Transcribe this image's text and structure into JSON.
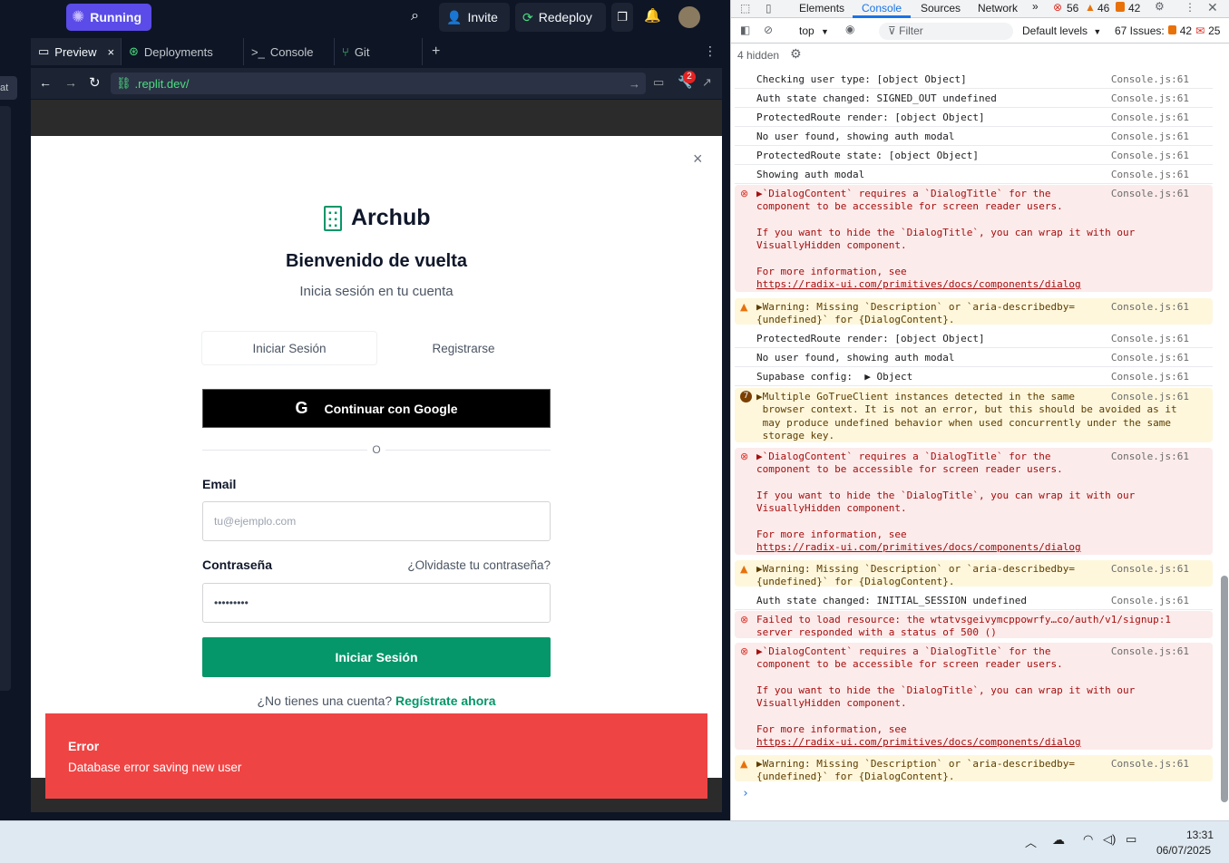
{
  "replit": {
    "run_status": "Running",
    "invite_label": "Invite",
    "redeploy_label": "Redeploy",
    "notif_badge": "2",
    "left_hint": "at",
    "tabs": [
      "Preview",
      "Deployments",
      "Console",
      "Git"
    ],
    "url_text": ".replit.dev/"
  },
  "login": {
    "brand": "Archub",
    "title": "Bienvenido de vuelta",
    "subtitle": "Inicia sesión en tu cuenta",
    "tab_login": "Iniciar Sesión",
    "tab_register": "Registrarse",
    "google_btn": "Continuar con Google",
    "divider": "O",
    "email_label": "Email",
    "email_placeholder": "tu@ejemplo.com",
    "password_label": "Contraseña",
    "forgot": "¿Olvidaste tu contraseña?",
    "password_value": "•••••••••",
    "submit": "Iniciar Sesión",
    "no_account": "¿No tienes una cuenta?",
    "register_link": "Regístrate ahora"
  },
  "toast": {
    "title": "Error",
    "message": "Database error saving new user"
  },
  "devtools": {
    "tabs": [
      "Elements",
      "Console",
      "Sources",
      "Network"
    ],
    "err_count": "56",
    "warn_count": "46",
    "info_count": "42",
    "context": "top",
    "filter_placeholder": "Filter",
    "levels": "Default levels",
    "issues_label": "67 Issues:",
    "issues_warn": "42",
    "issues_info": "25",
    "hidden": "4 hidden",
    "messages": [
      {
        "type": "log",
        "text": "Checking user type: [object Object]",
        "src": "Console.js:61"
      },
      {
        "type": "log",
        "text": "Auth state changed: SIGNED_OUT undefined",
        "src": "Console.js:61"
      },
      {
        "type": "log",
        "text": "ProtectedRoute render: [object Object]",
        "src": "Console.js:61"
      },
      {
        "type": "log",
        "text": "No user found, showing auth modal",
        "src": "Console.js:61"
      },
      {
        "type": "log",
        "text": "ProtectedRoute state: [object Object]",
        "src": "Console.js:61"
      },
      {
        "type": "log",
        "text": "Showing auth modal",
        "src": "Console.js:61"
      },
      {
        "type": "error",
        "text": "▶`DialogContent` requires a `DialogTitle` for the\ncomponent to be accessible for screen reader users.\n\nIf you want to hide the `DialogTitle`, you can wrap it with our\nVisuallyHidden component.\n\nFor more information, see",
        "link": "https://radix-ui.com/primitives/docs/components/dialog",
        "src": "Console.js:61"
      },
      {
        "type": "warn",
        "text": "▶Warning: Missing `Description` or `aria-describedby=\n{undefined}` for {DialogContent}.",
        "src": "Console.js:61"
      },
      {
        "type": "log",
        "text": "ProtectedRoute render: [object Object]",
        "src": "Console.js:61"
      },
      {
        "type": "log",
        "text": "No user found, showing auth modal",
        "src": "Console.js:61"
      },
      {
        "type": "log",
        "text": "Supabase config:  ▶ Object",
        "src": "Console.js:61"
      },
      {
        "type": "warn",
        "badge": "7",
        "text": "▶Multiple GoTrueClient instances detected in the same\n browser context. It is not an error, but this should be avoided as it\n may produce undefined behavior when used concurrently under the same\n storage key.",
        "src": "Console.js:61"
      },
      {
        "type": "error",
        "text": "▶`DialogContent` requires a `DialogTitle` for the\ncomponent to be accessible for screen reader users.\n\nIf you want to hide the `DialogTitle`, you can wrap it with our\nVisuallyHidden component.\n\nFor more information, see",
        "link": "https://radix-ui.com/primitives/docs/components/dialog",
        "src": "Console.js:61"
      },
      {
        "type": "warn",
        "text": "▶Warning: Missing `Description` or `aria-describedby=\n{undefined}` for {DialogContent}.",
        "src": "Console.js:61"
      },
      {
        "type": "log",
        "text": "Auth state changed: INITIAL_SESSION undefined",
        "src": "Console.js:61"
      },
      {
        "type": "error",
        "text": "Failed to load resource: the wtatvsgeivymcppowrfy…co/auth/v1/signup:1\nserver responded with a status of 500 ()",
        "src": ""
      },
      {
        "type": "error",
        "text": "▶`DialogContent` requires a `DialogTitle` for the\ncomponent to be accessible for screen reader users.\n\nIf you want to hide the `DialogTitle`, you can wrap it with our\nVisuallyHidden component.\n\nFor more information, see",
        "link": "https://radix-ui.com/primitives/docs/components/dialog",
        "src": "Console.js:61"
      },
      {
        "type": "warn",
        "text": "▶Warning: Missing `Description` or `aria-describedby=\n{undefined}` for {DialogContent}.",
        "src": "Console.js:61"
      }
    ],
    "prompt": "›"
  },
  "taskbar": {
    "time": "13:31",
    "date": "06/07/2025"
  }
}
